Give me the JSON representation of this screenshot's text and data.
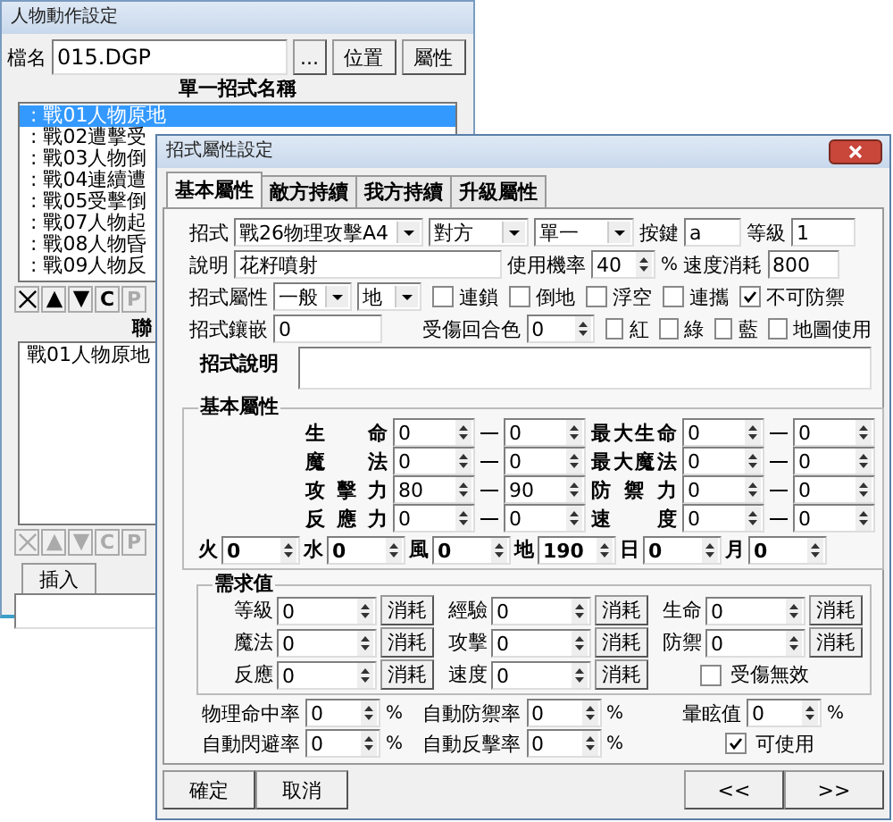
{
  "back_window": {
    "title": "人物動作設定",
    "file_label": "檔名",
    "file_name": "015.DGP",
    "browse_button": "...",
    "buttons": [
      "位置",
      "屬性"
    ],
    "list_header": "單一招式名稱",
    "moves": [
      {
        "text": ": 戰01人物原地",
        "selected": true
      },
      {
        "text": ": 戰02遭擊受",
        "selected": false
      },
      {
        "text": ": 戰03人物倒",
        "selected": false
      },
      {
        "text": ": 戰04連續遭",
        "selected": false
      },
      {
        "text": ": 戰05受擊倒",
        "selected": false
      },
      {
        "text": ": 戰07人物起",
        "selected": false
      },
      {
        "text": ": 戰08人物昏",
        "selected": false
      },
      {
        "text": ": 戰09人物反",
        "selected": false
      }
    ],
    "tools": [
      {
        "kind": "delete",
        "disabled": false
      },
      {
        "kind": "up",
        "disabled": false
      },
      {
        "kind": "down",
        "disabled": false
      },
      {
        "kind": "text",
        "label": "C",
        "disabled": false
      },
      {
        "kind": "text",
        "label": "P",
        "disabled": true
      }
    ],
    "sequence_header": "聯",
    "sequence": [
      {
        "text": "戰01人物原地",
        "selected": false
      }
    ],
    "sequence_tools": [
      {
        "kind": "delete",
        "disabled": true
      },
      {
        "kind": "up",
        "disabled": true
      },
      {
        "kind": "down",
        "disabled": true
      },
      {
        "kind": "text",
        "label": "C",
        "disabled": true
      },
      {
        "kind": "text",
        "label": "P",
        "disabled": true
      }
    ],
    "insert_button": "插入"
  },
  "dialog": {
    "title": "招式屬性設定",
    "tabs": [
      {
        "label": "基本屬性",
        "selected": true
      },
      {
        "label": "敵方持續",
        "selected": false
      },
      {
        "label": "我方持續",
        "selected": false
      },
      {
        "label": "升級屬性",
        "selected": false
      }
    ],
    "move_label": "招式",
    "move": "戰26物理攻擊A4",
    "target": "對方",
    "range": "單一",
    "key_label": "按鍵",
    "key": "a",
    "level_label": "等級",
    "level_value": "1",
    "desc_label": "說明",
    "desc": "花籽噴射",
    "rate_label": "使用機率",
    "rate": "40",
    "rate_unit": "%",
    "speed_label": "速度消耗",
    "speed": "800",
    "attr_label": "招式屬性",
    "attr_type": "一般",
    "attr_element": "地",
    "attr_flags": [
      {
        "label": "連鎖",
        "checked": false
      },
      {
        "label": "倒地",
        "checked": false
      },
      {
        "label": "浮空",
        "checked": false
      },
      {
        "label": "連攜",
        "checked": false
      },
      {
        "label": "不可防禦",
        "checked": true
      }
    ],
    "inlay_label": "招式鑲嵌",
    "inlay": "0",
    "color_label": "受傷回合色",
    "color_turns": "0",
    "color_flags": [
      {
        "label": "紅",
        "checked": false
      },
      {
        "label": "綠",
        "checked": false
      },
      {
        "label": "藍",
        "checked": false
      },
      {
        "label": "地圖使用",
        "checked": false
      }
    ],
    "note_label": "招式說明",
    "base_group": {
      "title": "基本屬性",
      "rows": [
        {
          "left": {
            "label": "生命",
            "min": "0",
            "max": "0"
          },
          "right": {
            "label": "最大生命",
            "min": "0",
            "max": "0"
          }
        },
        {
          "left": {
            "label": "魔法",
            "min": "0",
            "max": "0"
          },
          "right": {
            "label": "最大魔法",
            "min": "0",
            "max": "0"
          }
        },
        {
          "left": {
            "label": "攻擊力",
            "min": "80",
            "max": "90"
          },
          "right": {
            "label": "防禦力",
            "min": "0",
            "max": "0"
          }
        },
        {
          "left": {
            "label": "反應力",
            "min": "0",
            "max": "0"
          },
          "right": {
            "label": "速度",
            "min": "0",
            "max": "0"
          }
        }
      ]
    },
    "elements": [
      {
        "label": "火",
        "value": "0"
      },
      {
        "label": "水",
        "value": "0"
      },
      {
        "label": "風",
        "value": "0"
      },
      {
        "label": "地",
        "value": "190"
      },
      {
        "label": "日",
        "value": "0"
      },
      {
        "label": "月",
        "value": "0"
      }
    ],
    "req_group": {
      "title": "需求值",
      "items": [
        {
          "label": "等級",
          "value": "0",
          "button": "消耗"
        },
        {
          "label": "經驗",
          "value": "0",
          "button": "消耗"
        },
        {
          "label": "生命",
          "value": "0",
          "button": "消耗"
        },
        {
          "label": "魔法",
          "value": "0",
          "button": "消耗"
        },
        {
          "label": "攻擊",
          "value": "0",
          "button": "消耗"
        },
        {
          "label": "防禦",
          "value": "0",
          "button": "消耗"
        },
        {
          "label": "反應",
          "value": "0",
          "button": "消耗"
        },
        {
          "label": "速度",
          "value": "0",
          "button": "消耗"
        }
      ],
      "flag": {
        "label": "受傷無效",
        "checked": false
      }
    },
    "rates": [
      {
        "label": "物理命中率",
        "value": "0",
        "unit": "%"
      },
      {
        "label": "自動防禦率",
        "value": "0",
        "unit": "%"
      },
      {
        "label": "暈眩值",
        "value": "0",
        "unit": "%"
      },
      {
        "label": "自動閃避率",
        "value": "0",
        "unit": "%"
      },
      {
        "label": "自動反擊率",
        "value": "0",
        "unit": "%"
      }
    ],
    "usable": {
      "label": "可使用",
      "checked": true
    },
    "footer": {
      "ok": "確定",
      "cancel": "取消",
      "prev": "<<",
      "next": ">>"
    }
  }
}
